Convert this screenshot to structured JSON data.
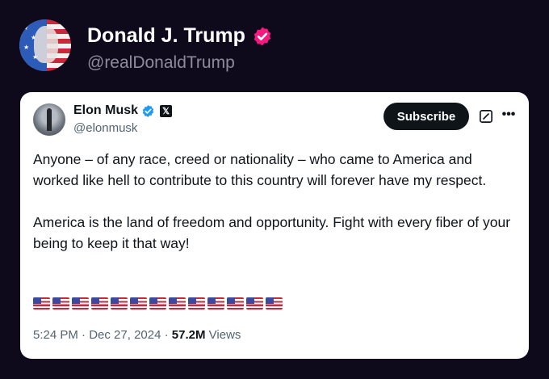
{
  "poster": {
    "name": "Donald J. Trump",
    "handle": "@realDonaldTrump"
  },
  "quoted_post": {
    "author_name": "Elon Musk",
    "author_handle": "@elonmusk",
    "subscribe_label": "Subscribe",
    "body": "Anyone – of any race, creed or nationality – who came to America and worked like hell to contribute to this country will forever have my respect.\n\nAmerica is the land of freedom and opportunity. Fight with every fiber of your being to keep it that way!",
    "flag_emoji_count": 13,
    "time": "5:24 PM",
    "separator": "·",
    "date": "Dec 27, 2024",
    "views_count": "57.2M",
    "views_label": "Views"
  },
  "colors": {
    "background": "#0e0a1c",
    "card": "#ffffff",
    "verified_pink": "#f91880",
    "verified_blue": "#1d9bf0",
    "secondary_text": "#536471"
  },
  "icons": [
    "verified-badge-icon",
    "x-logo-icon",
    "grok-icon",
    "more-icon",
    "us-flag-icon"
  ]
}
